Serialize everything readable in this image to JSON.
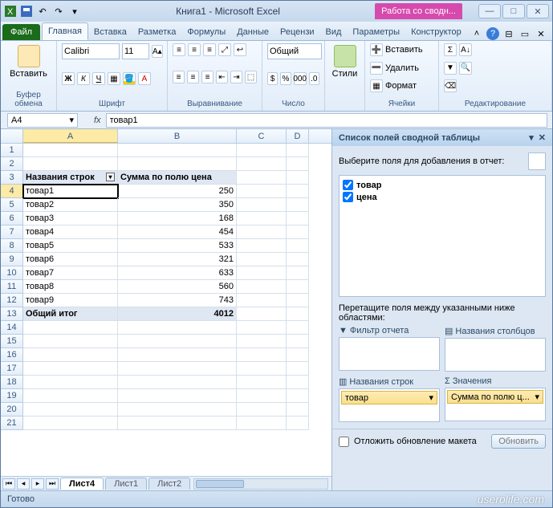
{
  "window": {
    "title": "Книга1  -  Microsoft Excel",
    "pivot_context": "Работа со сводн..."
  },
  "tabs": {
    "file": "Файл",
    "items": [
      "Главная",
      "Вставка",
      "Разметка",
      "Формулы",
      "Данные",
      "Рецензи",
      "Вид",
      "Параметры",
      "Конструктор"
    ],
    "active": "Главная"
  },
  "ribbon": {
    "clipboard": {
      "paste": "Вставить",
      "label": "Буфер обмена"
    },
    "font": {
      "family": "Calibri",
      "size": "11",
      "label": "Шрифт",
      "bold": "Ж",
      "italic": "К",
      "underline": "Ч"
    },
    "alignment": {
      "label": "Выравнивание"
    },
    "number": {
      "format": "Общий",
      "label": "Число"
    },
    "styles": {
      "btn": "Стили",
      "label": ""
    },
    "cells": {
      "insert": "Вставить",
      "delete": "Удалить",
      "format": "Формат",
      "label": "Ячейки"
    },
    "editing": {
      "label": "Редактирование"
    }
  },
  "formula_bar": {
    "namebox": "A4",
    "value": "товар1"
  },
  "grid": {
    "cols": [
      "A",
      "B",
      "C",
      "D"
    ],
    "header_row": 3,
    "headers": {
      "A": "Названия строк",
      "B": "Сумма по полю цена"
    },
    "rows": [
      {
        "n": 4,
        "A": "товар1",
        "B": 250
      },
      {
        "n": 5,
        "A": "товар2",
        "B": 350
      },
      {
        "n": 6,
        "A": "товар3",
        "B": 168
      },
      {
        "n": 7,
        "A": "товар4",
        "B": 454
      },
      {
        "n": 8,
        "A": "товар5",
        "B": 533
      },
      {
        "n": 9,
        "A": "товар6",
        "B": 321
      },
      {
        "n": 10,
        "A": "товар7",
        "B": 633
      },
      {
        "n": 11,
        "A": "товар8",
        "B": 560
      },
      {
        "n": 12,
        "A": "товар9",
        "B": 743
      }
    ],
    "total_row": {
      "n": 13,
      "A": "Общий итог",
      "B": 4012
    },
    "empty_rows": [
      1,
      2,
      14,
      15,
      16,
      17,
      18,
      19,
      20,
      21
    ],
    "active": "A4",
    "sheets": [
      "Лист4",
      "Лист1",
      "Лист2"
    ],
    "active_sheet": "Лист4"
  },
  "pane": {
    "title": "Список полей сводной таблицы",
    "choose": "Выберите поля для добавления в отчет:",
    "fields": [
      {
        "name": "товар",
        "checked": true
      },
      {
        "name": "цена",
        "checked": true
      }
    ],
    "drag": "Перетащите поля между указанными ниже областями:",
    "areas": {
      "filter": {
        "label": "Фильтр отчета",
        "items": []
      },
      "cols": {
        "label": "Названия столбцов",
        "items": []
      },
      "rows": {
        "label": "Названия строк",
        "items": [
          "товар"
        ]
      },
      "vals": {
        "label": "Значения",
        "items": [
          "Сумма по полю ц..."
        ]
      }
    },
    "defer": "Отложить обновление макета",
    "update": "Обновить"
  },
  "status": "Готово",
  "watermark": "userolife.com"
}
